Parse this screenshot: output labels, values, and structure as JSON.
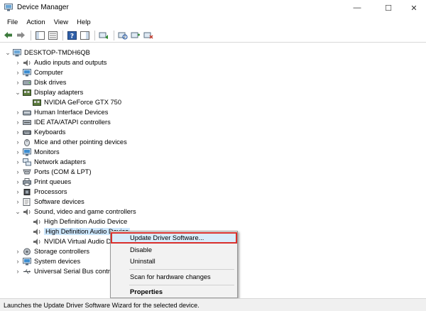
{
  "window": {
    "title": "Device Manager",
    "minimize_glyph": "—",
    "maximize_glyph": "☐",
    "close_glyph": "✕"
  },
  "menu": [
    "File",
    "Action",
    "View",
    "Help"
  ],
  "toolbar": {
    "icons": [
      "back-arrow-icon",
      "forward-arrow-icon",
      "show-hide-console-tree-icon",
      "properties-icon",
      "help-icon",
      "action-pane-icon",
      "update-driver-icon",
      "scan-hardware-icon",
      "add-legacy-hardware-icon",
      "uninstall-device-icon"
    ]
  },
  "tree": {
    "root": {
      "label": "DESKTOP-TMDH6QB",
      "icon": "computer-icon",
      "expanded": true
    },
    "nodes": [
      {
        "label": "Audio inputs and outputs",
        "icon": "speaker-icon",
        "chevron": "›"
      },
      {
        "label": "Computer",
        "icon": "monitor-icon",
        "chevron": "›"
      },
      {
        "label": "Disk drives",
        "icon": "disk-drive-icon",
        "chevron": "›"
      },
      {
        "label": "Display adapters",
        "icon": "display-adapter-icon",
        "chevron": "⌄"
      },
      {
        "label": "NVIDIA GeForce GTX 750",
        "icon": "display-adapter-icon",
        "chevron": ""
      },
      {
        "label": "Human Interface Devices",
        "icon": "hid-icon",
        "chevron": "›"
      },
      {
        "label": "IDE ATA/ATAPI controllers",
        "icon": "ide-controller-icon",
        "chevron": "›"
      },
      {
        "label": "Keyboards",
        "icon": "keyboard-icon",
        "chevron": "›"
      },
      {
        "label": "Mice and other pointing devices",
        "icon": "mouse-icon",
        "chevron": "›"
      },
      {
        "label": "Monitors",
        "icon": "monitor-icon",
        "chevron": "›"
      },
      {
        "label": "Network adapters",
        "icon": "network-adapter-icon",
        "chevron": "›"
      },
      {
        "label": "Ports (COM & LPT)",
        "icon": "port-icon",
        "chevron": "›"
      },
      {
        "label": "Print queues",
        "icon": "printer-icon",
        "chevron": "›"
      },
      {
        "label": "Processors",
        "icon": "processor-icon",
        "chevron": "›"
      },
      {
        "label": "Software devices",
        "icon": "software-device-icon",
        "chevron": "›"
      },
      {
        "label": "Sound, video and game controllers",
        "icon": "speaker-icon",
        "chevron": "⌄"
      },
      {
        "label": "High Definition Audio Device",
        "icon": "speaker-icon",
        "chevron": ""
      },
      {
        "label": "High Definition Audio Device",
        "icon": "speaker-icon",
        "chevron": "",
        "selected": true
      },
      {
        "label": "NVIDIA Virtual Audio Device (Wave Extensible) (WDM)",
        "icon": "speaker-icon",
        "chevron": ""
      },
      {
        "label": "Storage controllers",
        "icon": "storage-controller-icon",
        "chevron": "›"
      },
      {
        "label": "System devices",
        "icon": "system-device-icon",
        "chevron": "›"
      },
      {
        "label": "Universal Serial Bus controllers",
        "icon": "usb-icon",
        "chevron": "›"
      }
    ]
  },
  "context_menu": {
    "update": "Update Driver Software...",
    "disable": "Disable",
    "uninstall": "Uninstall",
    "scan": "Scan for hardware changes",
    "properties": "Properties"
  },
  "status": "Launches the Update Driver Software Wizard for the selected device.",
  "colors": {
    "highlight_border": "#d9302c",
    "highlight_bg": "#d9ecfb",
    "selection_bg": "#cde8ff"
  }
}
